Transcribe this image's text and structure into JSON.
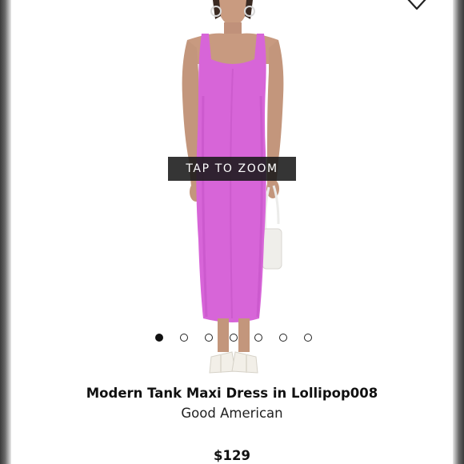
{
  "gallery": {
    "zoom_label": "TAP TO ZOOM",
    "slide_count": 7,
    "active_slide": 1
  },
  "product": {
    "title": "Modern Tank Maxi Dress in Lollipop008",
    "brand": "Good American",
    "price": "$129",
    "dress_color": "#d765d8"
  },
  "icons": {
    "wishlist": "heart-icon"
  }
}
